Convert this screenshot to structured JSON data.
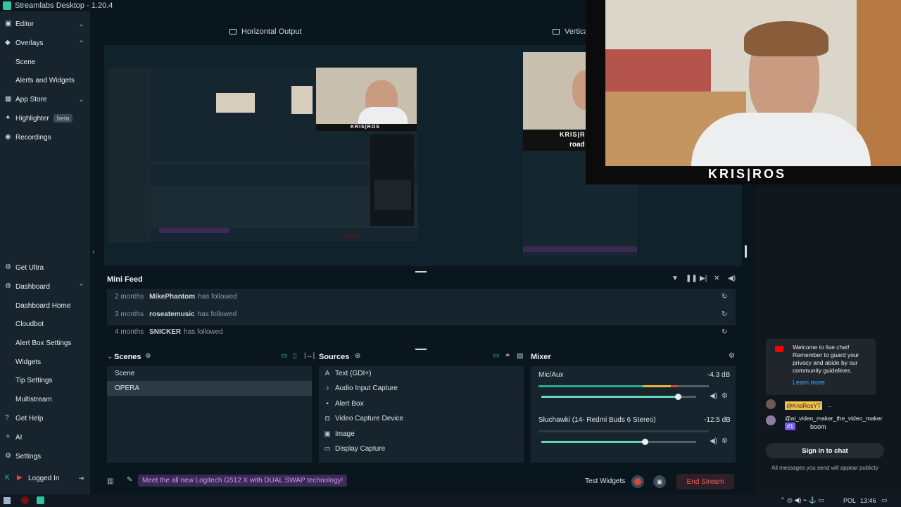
{
  "app": {
    "title": "Streamlabs Desktop - 1.20.4"
  },
  "sidebar": {
    "items": [
      {
        "label": "Editor",
        "icon": "editor-icon",
        "chevron": "⌄"
      },
      {
        "label": "Overlays",
        "icon": "overlays-icon",
        "chevron": "⌃"
      },
      {
        "label": "Scene",
        "icon": "",
        "chevron": ""
      },
      {
        "label": "Alerts and Widgets",
        "icon": "",
        "chevron": ""
      },
      {
        "label": "App Store",
        "icon": "app-store-icon",
        "chevron": "⌄"
      },
      {
        "label": "Highlighter",
        "icon": "highlighter-icon",
        "badge": "beta"
      },
      {
        "label": "Recordings",
        "icon": "recordings-icon"
      }
    ],
    "bottom_items": [
      {
        "label": "Get Ultra",
        "icon": "ultra-icon"
      },
      {
        "label": "Dashboard",
        "icon": "dashboard-icon",
        "chevron": "⌃"
      },
      {
        "label": "Dashboard Home"
      },
      {
        "label": "Cloudbot"
      },
      {
        "label": "Alert Box Settings"
      },
      {
        "label": "Widgets"
      },
      {
        "label": "Tip Settings"
      },
      {
        "label": "Multistream"
      },
      {
        "label": "Get Help",
        "icon": "help-icon"
      },
      {
        "label": "AI",
        "icon": "ai-icon"
      },
      {
        "label": "Settings",
        "icon": "settings-icon"
      },
      {
        "label": "Logged In",
        "icon": "user-icon"
      }
    ]
  },
  "outputs": {
    "horizontal": "Horizontal Output",
    "vertical": "Vertica"
  },
  "overlay_text": {
    "watermark": "KRIS|ROS",
    "vertical_text": "road to 50"
  },
  "mini_feed": {
    "title": "Mini Feed",
    "rows": [
      {
        "time": "2 months",
        "name": "MikePhantom",
        "action": "has followed"
      },
      {
        "time": "3 months",
        "name": "roseatemusic",
        "action": "has followed"
      },
      {
        "time": "4 months",
        "name": "SNICKER",
        "action": "has followed"
      }
    ]
  },
  "scenes": {
    "title": "Scenes",
    "items": [
      "Scene",
      "OPERA"
    ],
    "selected": "OPERA"
  },
  "sources": {
    "title": "Sources",
    "items": [
      "Text (GDI+)",
      "Audio Input Capture",
      "Alert Box",
      "Video Capture Device",
      "Image",
      "Display Capture"
    ]
  },
  "mixer": {
    "title": "Mixer",
    "channels": [
      {
        "name": "Mic/Aux",
        "db": "-4.3 dB",
        "level": 0.82,
        "volume": 0.88
      },
      {
        "name": "Słuchawki (14- Redmi Buds 6 Stereo)",
        "db": "-12.5 dB",
        "level": 0.0,
        "volume": 0.67
      }
    ]
  },
  "bottom": {
    "promo": "Meet the all new Logitech G512 X with DUAL SWAP technology!",
    "test_widgets": "Test Widgets",
    "end_stream": "End Stream"
  },
  "chat": {
    "notice": "Welcome to live chat! Remember to guard your privacy and abide by our community guidelines.",
    "learn_more": "Learn more",
    "messages": [
      {
        "user": "@KrisRosYT",
        "text": ".."
      },
      {
        "user": "@ai_video_maker_the_video_maker",
        "badge": "#1",
        "text": "boom"
      }
    ],
    "sign_in": "Sign in to chat",
    "footer": "All messages you send will appear publicly"
  },
  "taskbar": {
    "lang": "POL",
    "time": "13:46"
  },
  "colors": {
    "accent": "#31c3a2",
    "danger": "#f26363",
    "promo": "#c79af2"
  }
}
